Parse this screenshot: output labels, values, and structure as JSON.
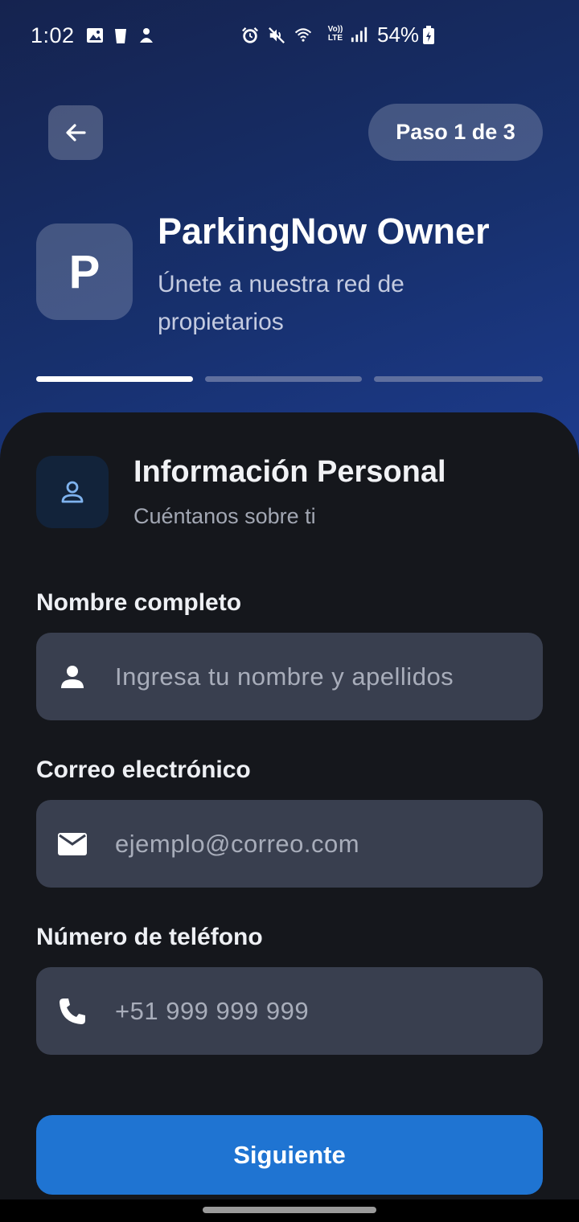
{
  "status_bar": {
    "time": "1:02",
    "battery": "54%",
    "left_icons": [
      "image-icon",
      "clipboard-icon",
      "notification-icon"
    ],
    "right_icons": [
      "alarm-icon",
      "mute-icon",
      "wifi-icon",
      "volte-icon",
      "signal-icon",
      "battery-icon"
    ]
  },
  "header": {
    "step_label": "Paso 1 de 3",
    "logo_letter": "P",
    "app_title": "ParkingNow Owner",
    "app_subtitle": "Únete a nuestra red de propietarios",
    "progress": {
      "total_steps": 3,
      "current_step": 1,
      "active_color": "#ffffff",
      "inactive_color": "#5f6f9e"
    }
  },
  "section": {
    "title": "Información Personal",
    "subtitle": "Cuéntanos sobre ti",
    "icon": "person-outline-icon"
  },
  "form": {
    "full_name": {
      "label": "Nombre completo",
      "placeholder": "Ingresa tu nombre y apellidos",
      "value": "",
      "icon": "person-icon"
    },
    "email": {
      "label": "Correo electrónico",
      "placeholder": "ejemplo@correo.com",
      "value": "",
      "icon": "mail-icon"
    },
    "phone": {
      "label": "Número de teléfono",
      "placeholder": "+51 999 999 999",
      "value": "",
      "icon": "phone-icon"
    }
  },
  "actions": {
    "next_label": "Siguiente"
  },
  "colors": {
    "accent": "#1f74d2",
    "hero_bg": "#17306d",
    "card_bg": "#15171c",
    "field_bg": "#393f4f"
  }
}
